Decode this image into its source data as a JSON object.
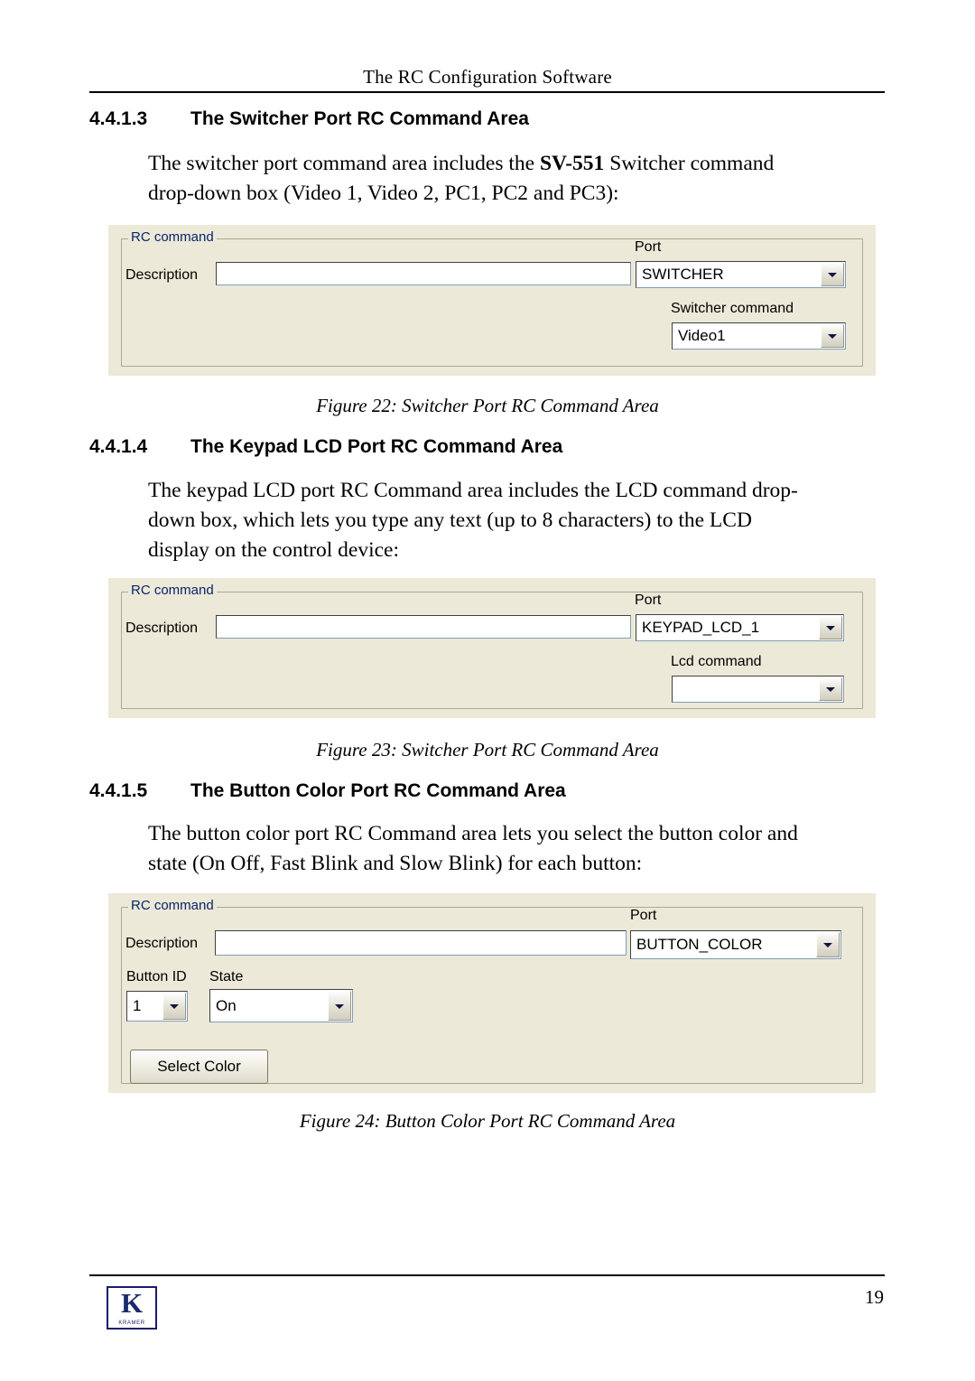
{
  "header": {
    "running_head": "The RC Configuration Software",
    "page_number": "19",
    "logo_letter": "K",
    "logo_brand": "KRAMER"
  },
  "sections": [
    {
      "number": "4.4.1.3",
      "title": "The Switcher Port RC Command Area",
      "paragraph_line1": "The switcher port command area includes the ",
      "paragraph_bold": "SV-551",
      "paragraph_line1_end": " Switcher command",
      "paragraph_line2": "drop-down box (Video 1, Video 2, PC1, PC2 and PC3):"
    },
    {
      "number": "4.4.1.4",
      "title": "The Keypad LCD Port RC Command Area",
      "paragraph_line1": "The keypad LCD port RC Command area includes the LCD command drop-",
      "paragraph_line2": "down box, which lets you type any text (up to 8 characters) to the LCD",
      "paragraph_line3": "display on the control device:"
    },
    {
      "number": "4.4.1.5",
      "title": "The Button Color Port RC Command Area",
      "paragraph_line1": "The button color port RC Command area lets you select the button color and",
      "paragraph_line2": "state (On Off, Fast Blink and Slow Blink) for each button:"
    }
  ],
  "figures": [
    {
      "id": "fig22",
      "caption": "Figure 22: Switcher Port RC Command Area",
      "group_title": "RC command",
      "description_label": "Description",
      "description_value": "",
      "port_label": "Port",
      "port_value": "SWITCHER",
      "command_label": "Switcher command",
      "command_value": "Video1"
    },
    {
      "id": "fig23",
      "caption": "Figure 23: Switcher Port RC Command Area",
      "group_title": "RC command",
      "description_label": "Description",
      "description_value": "",
      "port_label": "Port",
      "port_value": "KEYPAD_LCD_1",
      "command_label": "Lcd command",
      "command_value": ""
    },
    {
      "id": "fig24",
      "caption": "Figure 24: Button Color Port RC Command Area",
      "group_title": "RC command",
      "description_label": "Description",
      "description_value": "",
      "port_label": "Port",
      "port_value": "BUTTON_COLOR",
      "button_id_label": "Button ID",
      "button_id_value": "1",
      "state_label": "State",
      "state_value": "On",
      "select_color_label": "Select Color"
    }
  ],
  "colors": {
    "dialog_face": "#ece9d8",
    "group_title": "#0a246a",
    "border": "#aca899"
  }
}
